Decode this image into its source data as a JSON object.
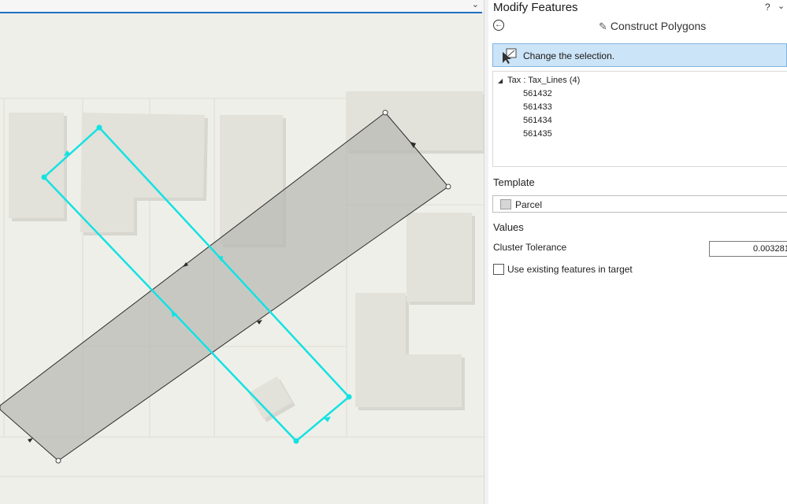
{
  "pane": {
    "title": "Modify Features",
    "help": "?",
    "chevron": "⌄",
    "back": "←",
    "tool_name": "Construct Polygons",
    "banner": "Change the selection.",
    "tree": {
      "group": "Tax : Tax_Lines (4)",
      "items": [
        "561432",
        "561433",
        "561434",
        "561435"
      ]
    },
    "template_heading": "Template",
    "template_name": "Parcel",
    "values_heading": "Values",
    "cluster_label": "Cluster Tolerance",
    "cluster_value": "0.003281",
    "checkbox_label": "Use existing features in target"
  },
  "map": {
    "chevron": "⌄",
    "colors": {
      "background": "#efefe9",
      "building": "#e2e1da",
      "polygon_fill": "#b9b9b4",
      "selection": "#13e2e2",
      "accent": "#1e6fc0"
    }
  }
}
